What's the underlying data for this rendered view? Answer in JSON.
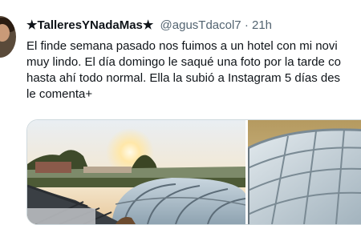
{
  "tweet": {
    "display_name": "★TalleresYNadaMas★",
    "handle": "@agusTdacol7",
    "separator": "·",
    "time": "21h",
    "text_lines": [
      "El finde semana pasado nos fuimos a un hotel con mi novi",
      "muy lindo. El día domingo le saqué una foto por la tarde co",
      "hasta ahí todo normal. Ella la subió a Instagram 5 días des",
      "le comenta+"
    ]
  }
}
